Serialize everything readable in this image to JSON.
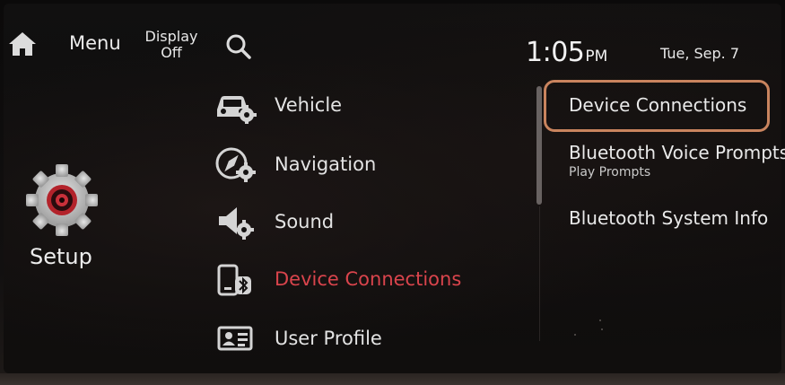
{
  "top_bar": {
    "home_icon": "home-icon",
    "menu_label": "Menu",
    "display_off_line1": "Display",
    "display_off_line2": "Off",
    "search_icon": "search-icon",
    "time": "1:05",
    "ampm": "PM",
    "date": "Tue, Sep. 7"
  },
  "setup": {
    "icon": "gear-icon",
    "label": "Setup"
  },
  "menu": {
    "items": [
      {
        "label": "Vehicle",
        "icon": "car-gear-icon",
        "active": false
      },
      {
        "label": "Navigation",
        "icon": "compass-gear-icon",
        "active": false
      },
      {
        "label": "Sound",
        "icon": "speaker-gear-icon",
        "active": false
      },
      {
        "label": "Device Connections",
        "icon": "phone-bluetooth-icon",
        "active": true
      },
      {
        "label": "User Profile",
        "icon": "id-card-icon",
        "active": false
      }
    ]
  },
  "submenu": {
    "items": [
      {
        "label": "Device Connections",
        "secondary": ""
      },
      {
        "label": "Bluetooth Voice Prompts",
        "secondary": "Play Prompts"
      },
      {
        "label": "Bluetooth System Info",
        "secondary": ""
      }
    ]
  },
  "colors": {
    "active_red": "#d9444c",
    "highlight_orange": "#c9845e",
    "text_white": "#e6e6e6",
    "background": "#0d0c0c"
  }
}
